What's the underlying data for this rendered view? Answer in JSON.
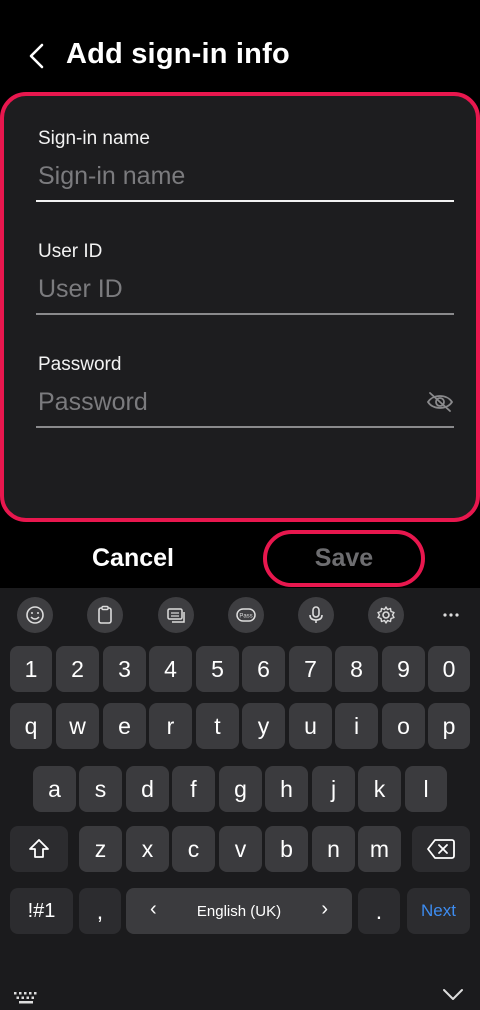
{
  "header": {
    "title": "Add sign-in info",
    "back_icon": "chevron-left-icon"
  },
  "form": {
    "fields": [
      {
        "label": "Sign-in name",
        "value": "",
        "placeholder": "Sign-in name",
        "active": true
      },
      {
        "label": "User ID",
        "value": "",
        "placeholder": "User ID",
        "active": false
      },
      {
        "label": "Password",
        "value": "",
        "placeholder": "Password",
        "active": false,
        "trailing_icon": "eye-off-icon"
      }
    ],
    "highlight_color": "#e8174e"
  },
  "actions": {
    "cancel_label": "Cancel",
    "save_label": "Save"
  },
  "keyboard": {
    "toolbar": [
      "emoji-icon",
      "clipboard-icon",
      "keyboard-mode-icon",
      "samsung-pass-icon",
      "microphone-icon",
      "settings-icon",
      "more-icon"
    ],
    "number_row": [
      "1",
      "2",
      "3",
      "4",
      "5",
      "6",
      "7",
      "8",
      "9",
      "0"
    ],
    "row1": [
      "q",
      "w",
      "e",
      "r",
      "t",
      "y",
      "u",
      "i",
      "o",
      "p"
    ],
    "row2": [
      "a",
      "s",
      "d",
      "f",
      "g",
      "h",
      "j",
      "k",
      "l"
    ],
    "row3": [
      "z",
      "x",
      "c",
      "v",
      "b",
      "n",
      "m"
    ],
    "symbols_label": "!#1",
    "comma_label": ",",
    "period_label": ".",
    "language_label": "English (UK)",
    "lang_prev": "‹",
    "lang_next": "›",
    "next_label": "Next",
    "next_color": "#3d8cf0"
  }
}
